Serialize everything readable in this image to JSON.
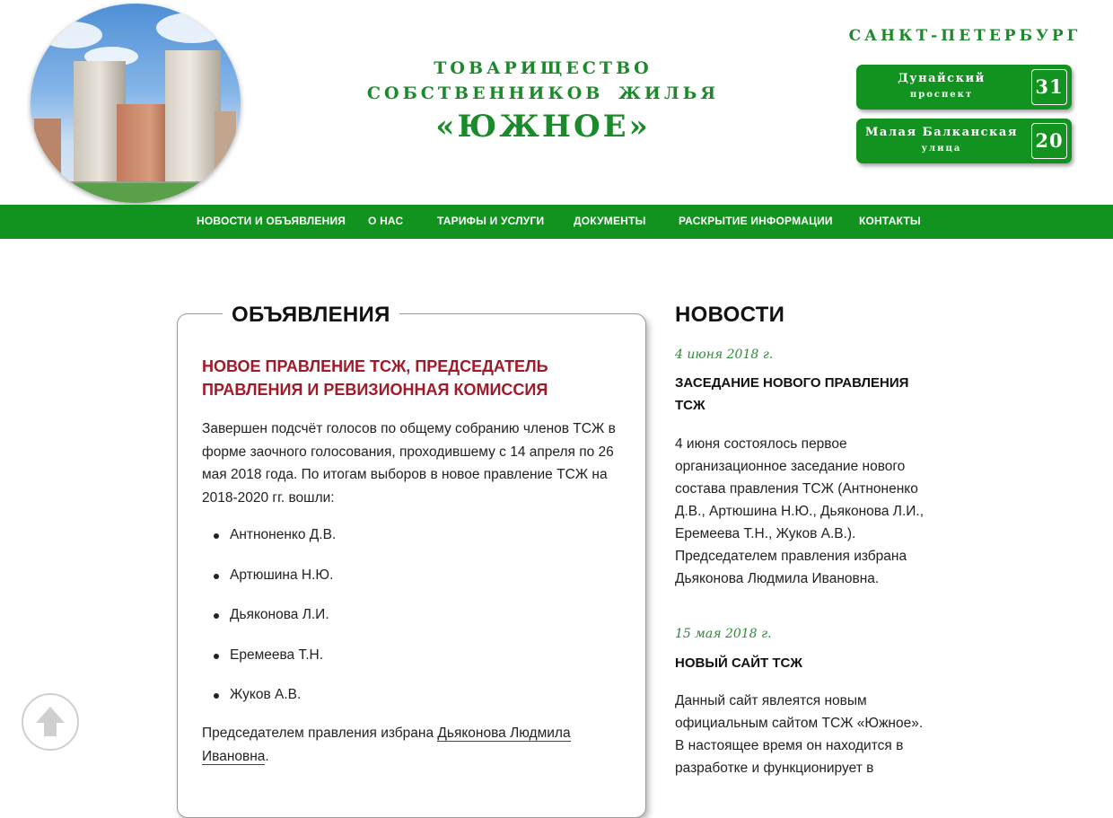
{
  "header": {
    "title_line1": "ТОВАРИЩЕСТВО",
    "title_line2": "СОБСТВЕННИКОВ ЖИЛЬЯ",
    "title_line3": "«ЮЖНОЕ»",
    "city": "САНКТ-ПЕТЕРБУРГ",
    "addresses": [
      {
        "street": "Дунайский",
        "kind": "проспект",
        "number": "31"
      },
      {
        "street": "Малая Балканская",
        "kind": "улица",
        "number": "20"
      }
    ]
  },
  "nav": {
    "items": [
      {
        "label": "НОВОСТИ И ОБЪЯВЛЕНИЯ"
      },
      {
        "label": "О НАС"
      },
      {
        "label": "ТАРИФЫ И УСЛУГИ"
      },
      {
        "label": "ДОКУМЕНТЫ"
      },
      {
        "label": "РАСКРЫТИЕ ИНФОРМАЦИИ"
      },
      {
        "label": "КОНТАКТЫ"
      }
    ]
  },
  "announcements": {
    "heading": "ОБЪЯВЛЕНИЯ",
    "title": "НОВОЕ ПРАВЛЕНИЕ ТСЖ, ПРЕДСЕДАТЕЛЬ ПРАВЛЕНИЯ И РЕВИЗИОННАЯ КОМИССИЯ",
    "intro": "Завершен подсчёт голосов по общему собранию членов ТСЖ в форме заочного голосования, проходившему с 14 апреля по 26 мая 2018 года. По итогам выборов в новое правление ТСЖ на 2018-2020 гг. вошли:",
    "members": [
      "Антноненко Д.В.",
      "Артюшина Н.Ю.",
      "Дьяконова Л.И.",
      "Еремеева Т.Н.",
      "Жуков А.В."
    ],
    "chair_prefix": "Председателем правления избрана ",
    "chair_name": "Дьяконова Людмила Ивановна",
    "chair_suffix": "."
  },
  "news": {
    "heading": "НОВОСТИ",
    "items": [
      {
        "date": "4 июня 2018 г.",
        "title": "ЗАСЕДАНИЕ НОВОГО ПРАВЛЕНИЯ ТСЖ",
        "text": "4 июня состоялось первое организационное заседание нового состава правления ТСЖ (Антноненко Д.В., Артюшина Н.Ю., Дьяконова Л.И., Еремеева Т.Н., Жуков А.В.). Председателем правления избрана Дьяконова Людмила Ивановна."
      },
      {
        "date": "15 мая 2018 г.",
        "title": "НОВЫЙ САЙТ ТСЖ",
        "text": "Данный сайт явлеятся новым официальным сайтом ТСЖ «Южное». В настоящее время он находится в разработке и функционирует в"
      }
    ]
  },
  "colors": {
    "brand_green": "#12921f",
    "title_red": "#a01a2a",
    "date_green": "#2f8a3a"
  }
}
